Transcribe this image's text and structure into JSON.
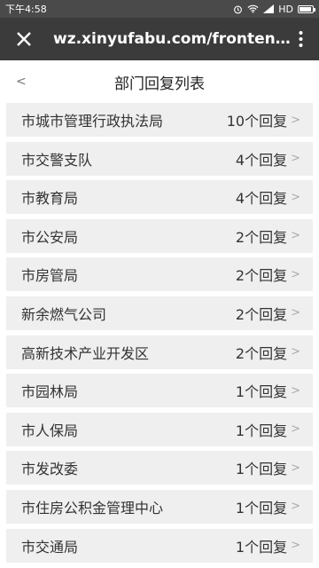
{
  "statusbar": {
    "time": "下午4:58",
    "network": "HD",
    "battery_level": 0.9
  },
  "browser": {
    "url": "wz.xinyufabu.com/frontend/..."
  },
  "header": {
    "back": "<",
    "title": "部门回复列表"
  },
  "list": [
    {
      "name": "市城市管理行政执法局",
      "count": "10个回复"
    },
    {
      "name": "市交警支队",
      "count": "4个回复"
    },
    {
      "name": "市教育局",
      "count": "4个回复"
    },
    {
      "name": "市公安局",
      "count": "2个回复"
    },
    {
      "name": "市房管局",
      "count": "2个回复"
    },
    {
      "name": "新余燃气公司",
      "count": "2个回复"
    },
    {
      "name": "高新技术产业开发区",
      "count": "2个回复"
    },
    {
      "name": "市园林局",
      "count": "1个回复"
    },
    {
      "name": "市人保局",
      "count": "1个回复"
    },
    {
      "name": "市发改委",
      "count": "1个回复"
    },
    {
      "name": "市住房公积金管理中心",
      "count": "1个回复"
    },
    {
      "name": "市交通局",
      "count": "1个回复"
    }
  ],
  "arrow": ">"
}
